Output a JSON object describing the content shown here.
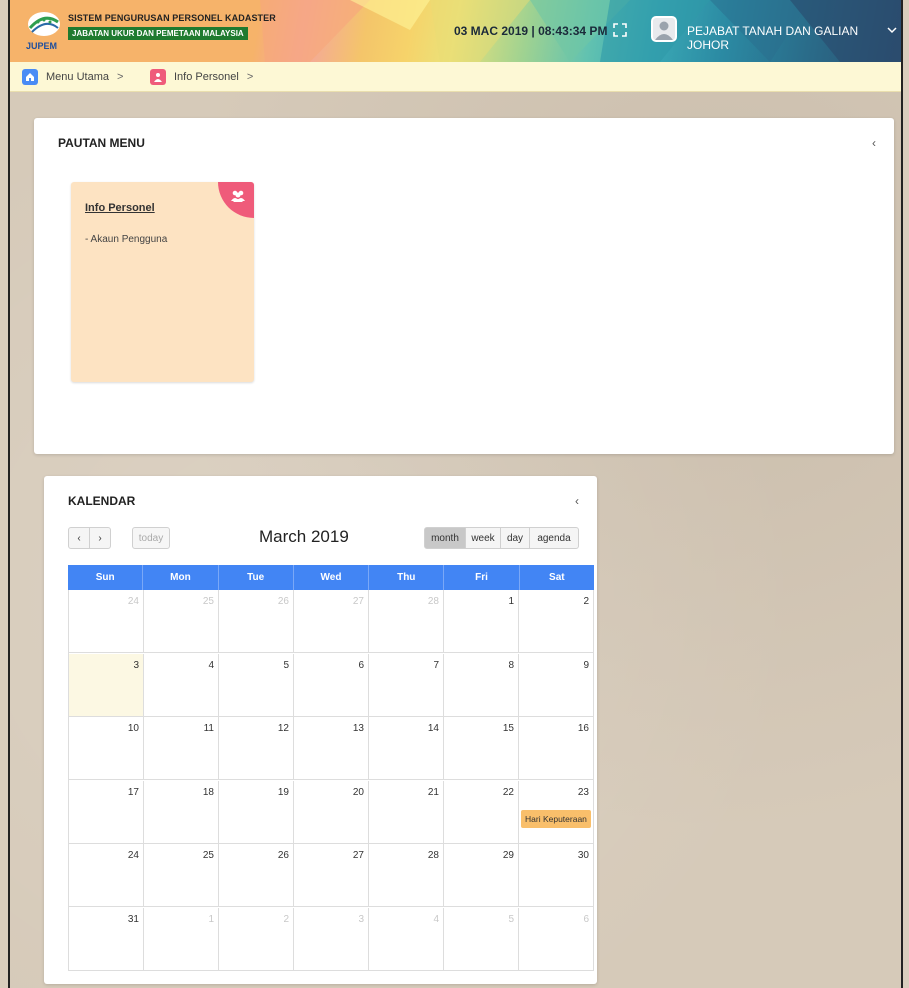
{
  "header": {
    "app_title": "SISTEM PENGURUSAN PERSONEL KADASTER",
    "agency": "JABATAN UKUR DAN PEMETAAN MALAYSIA",
    "logo_text": "JUPEM",
    "datetime": "03 MAC 2019 | 08:43:34 PM",
    "user_name": "PEJABAT TANAH DAN GALIAN JOHOR",
    "icons": [
      "expand-icon",
      "avatar-icon",
      "chevron-down-icon"
    ]
  },
  "breadcrumb": {
    "items": [
      {
        "label": "Menu Utama",
        "icon": "home-icon",
        "color": "#4a8cf5"
      },
      {
        "label": "Info Personel",
        "icon": "user-icon",
        "color": "#ef5b7a"
      }
    ],
    "separator": ">"
  },
  "menu_panel": {
    "title": "PAUTAN MENU",
    "collapse": "‹",
    "cards": [
      {
        "title": "Info Personel",
        "items": [
          "- Akaun Pengguna"
        ],
        "icon": "users-icon",
        "bg": "#fde3c2",
        "accent": "#ef5b7a"
      }
    ]
  },
  "calendar": {
    "title": "KALENDAR",
    "collapse": "‹",
    "prev": "‹",
    "next": "›",
    "today_label": "today",
    "month_title": "March 2019",
    "views": [
      "month",
      "week",
      "day",
      "agenda"
    ],
    "active_view": "month",
    "weekdays": [
      "Sun",
      "Mon",
      "Tue",
      "Wed",
      "Thu",
      "Fri",
      "Sat"
    ],
    "weeks": [
      [
        {
          "d": "24",
          "o": true
        },
        {
          "d": "25",
          "o": true
        },
        {
          "d": "26",
          "o": true
        },
        {
          "d": "27",
          "o": true
        },
        {
          "d": "28",
          "o": true
        },
        {
          "d": "1"
        },
        {
          "d": "2"
        }
      ],
      [
        {
          "d": "3",
          "today": true
        },
        {
          "d": "4"
        },
        {
          "d": "5"
        },
        {
          "d": "6"
        },
        {
          "d": "7"
        },
        {
          "d": "8"
        },
        {
          "d": "9"
        }
      ],
      [
        {
          "d": "10"
        },
        {
          "d": "11"
        },
        {
          "d": "12"
        },
        {
          "d": "13"
        },
        {
          "d": "14"
        },
        {
          "d": "15"
        },
        {
          "d": "16"
        }
      ],
      [
        {
          "d": "17"
        },
        {
          "d": "18"
        },
        {
          "d": "19"
        },
        {
          "d": "20"
        },
        {
          "d": "21"
        },
        {
          "d": "22"
        },
        {
          "d": "23",
          "event": "Hari Keputeraan"
        }
      ],
      [
        {
          "d": "24"
        },
        {
          "d": "25"
        },
        {
          "d": "26"
        },
        {
          "d": "27"
        },
        {
          "d": "28"
        },
        {
          "d": "29"
        },
        {
          "d": "30"
        }
      ],
      [
        {
          "d": "31"
        },
        {
          "d": "1",
          "o": true
        },
        {
          "d": "2",
          "o": true
        },
        {
          "d": "3",
          "o": true
        },
        {
          "d": "4",
          "o": true
        },
        {
          "d": "5",
          "o": true
        },
        {
          "d": "6",
          "o": true
        }
      ]
    ],
    "colors": {
      "header": "#4285f4",
      "today": "#fcf8e3",
      "event": "#f9bf6b"
    }
  }
}
